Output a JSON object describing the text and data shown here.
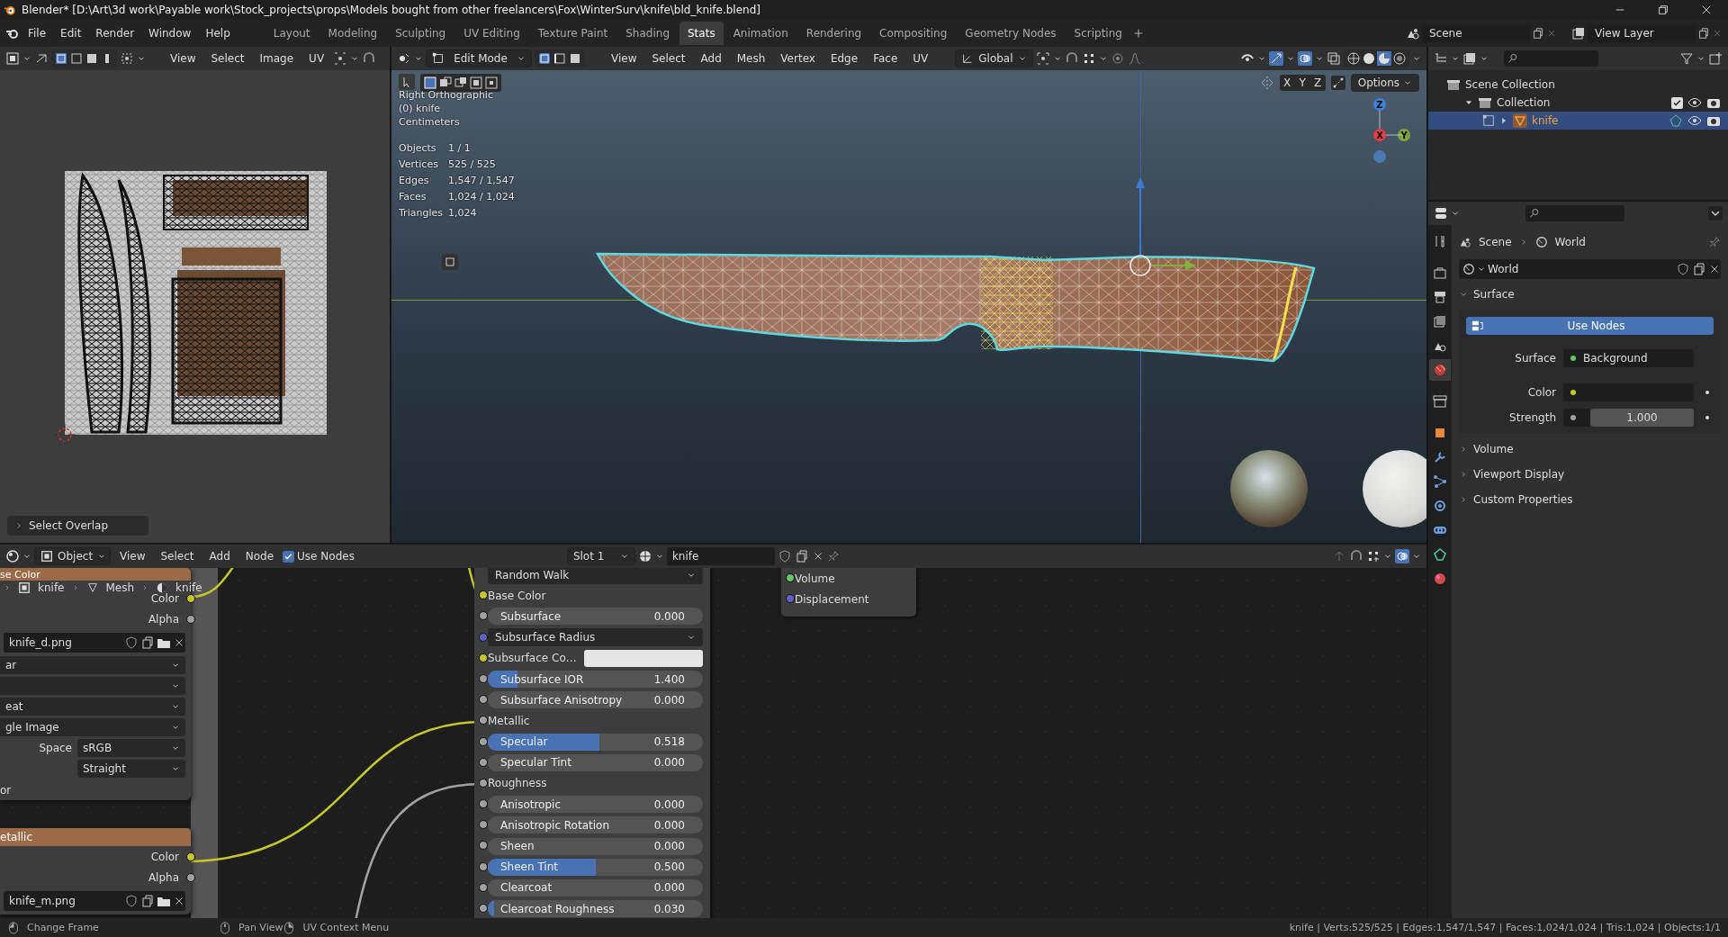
{
  "window": {
    "title": "Blender* [D:\\Art\\3d work\\Payable work\\Stock_projects\\props\\Models bought from other freelancers\\Fox\\WinterSurv\\knife\\bld_knife.blend]"
  },
  "menu": [
    "File",
    "Edit",
    "Render",
    "Window",
    "Help"
  ],
  "workspaces": [
    {
      "label": "Layout",
      "selected": false
    },
    {
      "label": "Modeling",
      "selected": false
    },
    {
      "label": "Sculpting",
      "selected": false
    },
    {
      "label": "UV Editing",
      "selected": false
    },
    {
      "label": "Texture Paint",
      "selected": false
    },
    {
      "label": "Shading",
      "selected": false
    },
    {
      "label": "Stats",
      "selected": true
    },
    {
      "label": "Animation",
      "selected": false
    },
    {
      "label": "Rendering",
      "selected": false
    },
    {
      "label": "Compositing",
      "selected": false
    },
    {
      "label": "Geometry Nodes",
      "selected": false
    },
    {
      "label": "Scripting",
      "selected": false
    }
  ],
  "scene": "Scene",
  "view_layer": "View Layer",
  "uv_editor": {
    "menu": [
      "View",
      "Select",
      "Image",
      "UV"
    ],
    "panel": "Select Overlap"
  },
  "viewport": {
    "mode": "Edit Mode",
    "menu": [
      "View",
      "Select",
      "Add",
      "Mesh",
      "Vertex",
      "Edge",
      "Face",
      "UV"
    ],
    "orientation": "Global",
    "axis_toggles": [
      "X",
      "Y",
      "Z"
    ],
    "options": "Options",
    "info": [
      "Right Orthographic",
      "(0) knife",
      "Centimeters"
    ],
    "stats": [
      {
        "label": "Objects",
        "value": "1 / 1"
      },
      {
        "label": "Vertices",
        "value": "525 / 525"
      },
      {
        "label": "Edges",
        "value": "1,547 / 1,547"
      },
      {
        "label": "Faces",
        "value": "1,024 / 1,024"
      },
      {
        "label": "Triangles",
        "value": "1,024"
      }
    ],
    "gizmo": [
      "Z",
      "X",
      "Y"
    ]
  },
  "outliner": {
    "items": [
      {
        "label": "Scene Collection",
        "selected": false,
        "children": [
          {
            "label": "Collection",
            "selected": false,
            "expanded": true,
            "checked": true,
            "children": [
              {
                "label": "knife",
                "selected": true,
                "expanded": false
              }
            ]
          }
        ]
      }
    ]
  },
  "properties": {
    "tabs": [
      {
        "kind": "tool",
        "selected": false
      },
      {
        "kind": "render",
        "selected": false
      },
      {
        "kind": "output",
        "selected": false
      },
      {
        "kind": "view-layer",
        "selected": false
      },
      {
        "kind": "scene",
        "selected": false
      },
      {
        "kind": "world",
        "selected": true
      },
      {
        "kind": "collection",
        "selected": false
      },
      {
        "kind": "object",
        "selected": false
      },
      {
        "kind": "modifier",
        "selected": false
      },
      {
        "kind": "particles",
        "selected": false
      },
      {
        "kind": "physics",
        "selected": false
      },
      {
        "kind": "constraints",
        "selected": false
      },
      {
        "kind": "data",
        "selected": false
      },
      {
        "kind": "material",
        "selected": false
      }
    ],
    "breadcrumb": [
      "Scene",
      "World"
    ],
    "world": "World",
    "panels": [
      {
        "label": "Surface",
        "expanded": true
      },
      {
        "label": "Volume",
        "expanded": false
      },
      {
        "label": "Viewport Display",
        "expanded": false
      },
      {
        "label": "Custom Properties",
        "expanded": false
      }
    ],
    "use_nodes": "Use Nodes",
    "surface": {
      "label": "Surface",
      "value": "Background"
    },
    "color": {
      "label": "Color"
    },
    "strength": {
      "label": "Strength",
      "value": "1.000"
    }
  },
  "node_editor": {
    "mode": "Object",
    "menu": [
      "View",
      "Select",
      "Add",
      "Node"
    ],
    "use_nodes": {
      "label": "Use Nodes",
      "checked": true
    },
    "slot": "Slot 1",
    "material": "knife",
    "breadcrumb": [
      "knife",
      "Mesh",
      "knife"
    ],
    "image_nodes": [
      {
        "title": "se Color",
        "outputs": [
          {
            "label": "Color",
            "color": "#c7c729"
          },
          {
            "label": "Alpha",
            "color": "#a1a1a1"
          }
        ],
        "image": "knife_d.png",
        "rows": [
          {
            "kind": "dropdown",
            "value": "ar"
          },
          {
            "kind": "dropdown"
          },
          {
            "kind": "dropdown",
            "value": "eat"
          },
          {
            "kind": "dropdown",
            "value": "gle Image"
          },
          {
            "kind": "labeled",
            "label": "Space",
            "value": "sRGB"
          },
          {
            "kind": "labeled",
            "value": "Straight"
          },
          {
            "kind": "text",
            "label": "or"
          }
        ]
      },
      {
        "title": "etallic",
        "outputs": [
          {
            "label": "Color",
            "color": "#c7c729"
          },
          {
            "label": "Alpha",
            "color": "#a1a1a1"
          }
        ],
        "image": "knife_m.png"
      }
    ],
    "bsdf": [
      {
        "kind": "dropdown",
        "value": "Random Walk"
      },
      {
        "kind": "socket",
        "label": "Base Color",
        "color": "#c7c729"
      },
      {
        "kind": "slider",
        "label": "Subsurface",
        "value": "0.000",
        "level": 0,
        "color": "#a1a1a1"
      },
      {
        "kind": "dropdown",
        "value": "Subsurface Radius",
        "color": "#6363c7"
      },
      {
        "kind": "swatch",
        "label": "Subsurface Co…",
        "color": "#c7c729"
      },
      {
        "kind": "slider",
        "label": "Subsurface IOR",
        "value": "1.400",
        "level": 0.14,
        "color": "#a1a1a1"
      },
      {
        "kind": "slider",
        "label": "Subsurface Anisotropy",
        "value": "0.000",
        "level": 0,
        "color": "#a1a1a1"
      },
      {
        "kind": "socket",
        "label": "Metallic",
        "color": "#a1a1a1"
      },
      {
        "kind": "slider",
        "label": "Specular",
        "value": "0.518",
        "level": 0.518,
        "color": "#a1a1a1"
      },
      {
        "kind": "slider",
        "label": "Specular Tint",
        "value": "0.000",
        "level": 0,
        "color": "#a1a1a1"
      },
      {
        "kind": "socket",
        "label": "Roughness",
        "color": "#a1a1a1"
      },
      {
        "kind": "slider",
        "label": "Anisotropic",
        "value": "0.000",
        "level": 0,
        "color": "#a1a1a1"
      },
      {
        "kind": "slider",
        "label": "Anisotropic Rotation",
        "value": "0.000",
        "level": 0,
        "color": "#a1a1a1"
      },
      {
        "kind": "slider",
        "label": "Sheen",
        "value": "0.000",
        "level": 0,
        "color": "#a1a1a1"
      },
      {
        "kind": "slider",
        "label": "Sheen Tint",
        "value": "0.500",
        "level": 0.5,
        "color": "#a1a1a1"
      },
      {
        "kind": "slider",
        "label": "Clearcoat",
        "value": "0.000",
        "level": 0,
        "color": "#a1a1a1"
      },
      {
        "kind": "slider",
        "label": "Clearcoat Roughness",
        "value": "0.030",
        "level": 0.03,
        "color": "#a1a1a1"
      }
    ],
    "output_sockets": [
      {
        "label": "Volume",
        "color": "#63c763"
      },
      {
        "label": "Displacement",
        "color": "#6363c7"
      }
    ]
  },
  "status_bar": {
    "hints": [
      "Change Frame",
      "Pan View",
      "UV Context Menu"
    ],
    "stats": "knife | Verts:525/525 | Edges:1,547/1,547 | Faces:1,024/1,024 | Tris:1,024 | Objects:1/1"
  }
}
